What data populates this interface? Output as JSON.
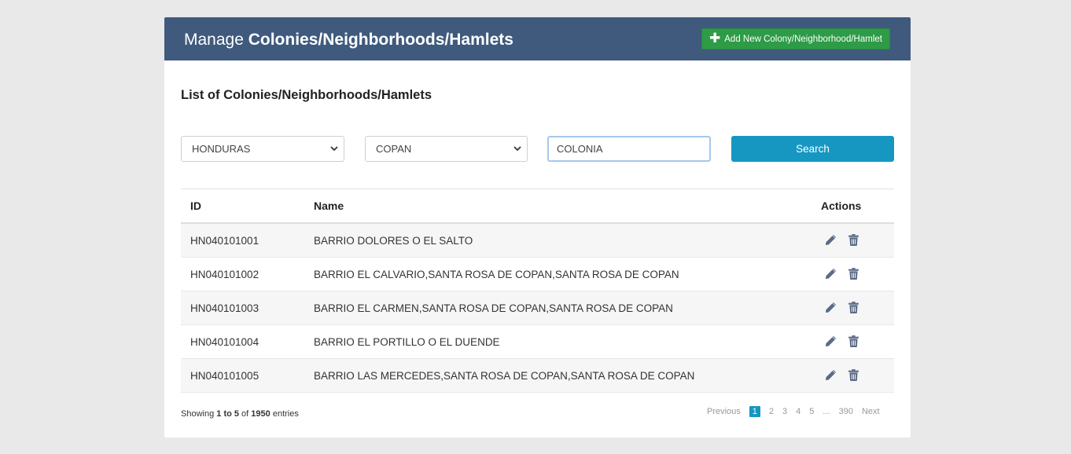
{
  "header": {
    "title_prefix": "Manage ",
    "title_bold": "Colonies/Neighborhoods/Hamlets",
    "add_button_label": "Add New Colony/Neighborhood/Hamlet"
  },
  "section_title": "List of Colonies/Neighborhoods/Hamlets",
  "filters": {
    "country_value": "HONDURAS",
    "department_value": "COPAN",
    "search_value": "COLONIA",
    "search_button_label": "Search"
  },
  "table": {
    "columns": {
      "id": "ID",
      "name": "Name",
      "actions": "Actions"
    },
    "rows": [
      {
        "id": "HN040101001",
        "name": "BARRIO DOLORES O EL SALTO"
      },
      {
        "id": "HN040101002",
        "name": "BARRIO EL CALVARIO,SANTA ROSA DE COPAN,SANTA ROSA DE COPAN"
      },
      {
        "id": "HN040101003",
        "name": "BARRIO EL CARMEN,SANTA ROSA DE COPAN,SANTA ROSA DE COPAN"
      },
      {
        "id": "HN040101004",
        "name": "BARRIO EL PORTILLO O EL DUENDE"
      },
      {
        "id": "HN040101005",
        "name": "BARRIO LAS MERCEDES,SANTA ROSA DE COPAN,SANTA ROSA DE COPAN"
      }
    ],
    "icons": {
      "edit": "pencil-icon",
      "delete": "trash-icon"
    }
  },
  "footer": {
    "showing_prefix": "Showing ",
    "range": "1 to 5",
    "of_word": " of ",
    "total": "1950",
    "entries_word": " entries"
  },
  "pagination": {
    "previous": "Previous",
    "pages": [
      "1",
      "2",
      "3",
      "4",
      "5",
      "...",
      "390"
    ],
    "next": "Next",
    "active_page": "1"
  },
  "colors": {
    "header_bg": "#3f5a7d",
    "add_button": "#2e9b47",
    "search_button": "#1597c2",
    "icon": "#5a6b85"
  }
}
